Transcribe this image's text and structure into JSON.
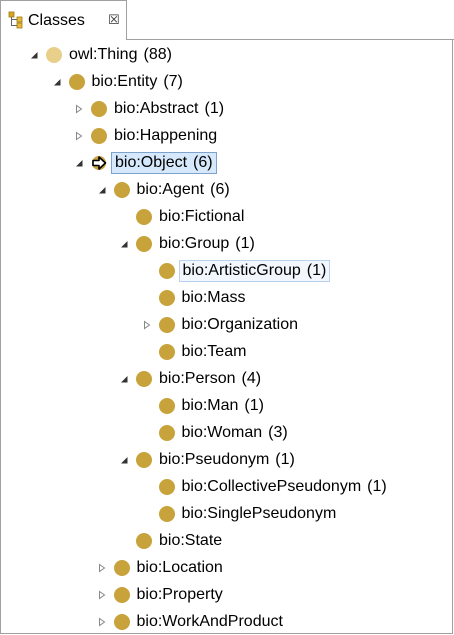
{
  "tab": {
    "title": "Classes",
    "close_glyph": "☒",
    "icon": "class-hierarchy-icon"
  },
  "colors": {
    "class_dot": "#c8a23a",
    "root_dot": "#e8cf8a",
    "selection_bg": "#d6e8fb",
    "selection_border": "#7da2ce"
  },
  "tree": [
    {
      "label": "owl:Thing",
      "count": "(88)",
      "depth": 0,
      "toggle": "expanded",
      "icon": "class-dot-light-icon"
    },
    {
      "label": "bio:Entity",
      "count": "(7)",
      "depth": 1,
      "toggle": "expanded",
      "icon": "class-dot-icon"
    },
    {
      "label": "bio:Abstract",
      "count": "(1)",
      "depth": 2,
      "toggle": "collapsed",
      "icon": "class-dot-icon"
    },
    {
      "label": "bio:Happening",
      "count": "",
      "depth": 2,
      "toggle": "collapsed",
      "icon": "class-dot-icon"
    },
    {
      "label": "bio:Object",
      "count": "(6)",
      "depth": 2,
      "toggle": "expanded",
      "icon": "object-arrow-icon",
      "state": "selected"
    },
    {
      "label": "bio:Agent",
      "count": "(6)",
      "depth": 3,
      "toggle": "expanded",
      "icon": "class-dot-icon"
    },
    {
      "label": "bio:Fictional",
      "count": "",
      "depth": 4,
      "toggle": "none",
      "icon": "class-dot-icon"
    },
    {
      "label": "bio:Group",
      "count": "(1)",
      "depth": 4,
      "toggle": "expanded",
      "icon": "class-dot-icon"
    },
    {
      "label": "bio:ArtisticGroup",
      "count": "(1)",
      "depth": 5,
      "toggle": "none",
      "icon": "class-dot-icon",
      "state": "highlight"
    },
    {
      "label": "bio:Mass",
      "count": "",
      "depth": 5,
      "toggle": "none",
      "icon": "class-dot-icon"
    },
    {
      "label": "bio:Organization",
      "count": "",
      "depth": 5,
      "toggle": "collapsed",
      "icon": "class-dot-icon"
    },
    {
      "label": "bio:Team",
      "count": "",
      "depth": 5,
      "toggle": "none",
      "icon": "class-dot-icon"
    },
    {
      "label": "bio:Person",
      "count": "(4)",
      "depth": 4,
      "toggle": "expanded",
      "icon": "class-dot-icon"
    },
    {
      "label": "bio:Man",
      "count": "(1)",
      "depth": 5,
      "toggle": "none",
      "icon": "class-dot-icon"
    },
    {
      "label": "bio:Woman",
      "count": "(3)",
      "depth": 5,
      "toggle": "none",
      "icon": "class-dot-icon"
    },
    {
      "label": "bio:Pseudonym",
      "count": "(1)",
      "depth": 4,
      "toggle": "expanded",
      "icon": "class-dot-icon"
    },
    {
      "label": "bio:CollectivePseudonym",
      "count": "(1)",
      "depth": 5,
      "toggle": "none",
      "icon": "class-dot-icon"
    },
    {
      "label": "bio:SinglePseudonym",
      "count": "",
      "depth": 5,
      "toggle": "none",
      "icon": "class-dot-icon"
    },
    {
      "label": "bio:State",
      "count": "",
      "depth": 4,
      "toggle": "none",
      "icon": "class-dot-icon"
    },
    {
      "label": "bio:Location",
      "count": "",
      "depth": 3,
      "toggle": "collapsed",
      "icon": "class-dot-icon"
    },
    {
      "label": "bio:Property",
      "count": "",
      "depth": 3,
      "toggle": "collapsed",
      "icon": "class-dot-icon"
    },
    {
      "label": "bio:WorkAndProduct",
      "count": "",
      "depth": 3,
      "toggle": "collapsed",
      "icon": "class-dot-icon"
    }
  ]
}
